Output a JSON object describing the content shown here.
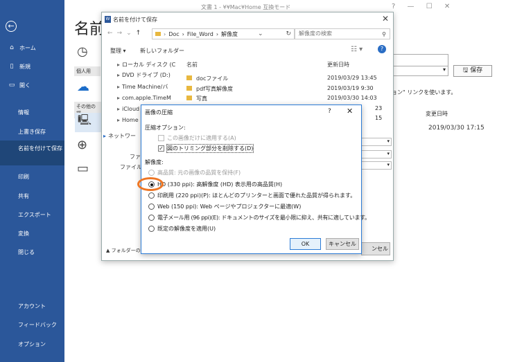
{
  "window": {
    "title": "文書 1 - ¥¥Mac¥Home 互換モード",
    "controls": [
      "?",
      "—",
      "☐",
      "✕"
    ]
  },
  "sidebar": {
    "items": [
      {
        "label": "ホーム",
        "icon": "home-icon"
      },
      {
        "label": "新規",
        "icon": "new-document-icon"
      },
      {
        "label": "開く",
        "icon": "open-folder-icon"
      },
      {
        "label": "情報"
      },
      {
        "label": "上書き保存"
      },
      {
        "label": "名前を付けて保存"
      },
      {
        "label": "印刷"
      },
      {
        "label": "共有"
      },
      {
        "label": "エクスポート"
      },
      {
        "label": "変換"
      },
      {
        "label": "閉じる"
      },
      {
        "label": "アカウント"
      },
      {
        "label": "フィードバック"
      },
      {
        "label": "オプション"
      }
    ]
  },
  "background": {
    "heading": "名前",
    "personal_label": "個人用",
    "other_label": "その他の場",
    "save_button": "保存",
    "note": "ョン\" リンクを使います。",
    "mod_date_header": "変更日時",
    "mod_date": "2019/03/30 17:15"
  },
  "saveas": {
    "title": "名前を付けて保存",
    "path": [
      "Doc",
      "File_Word",
      "解像度"
    ],
    "search_placeholder": "解像度の検索",
    "organize": "整理 ▾",
    "new_folder": "新しいフォルダー",
    "nav": [
      {
        "label": "ローカル ディスク (C"
      },
      {
        "label": "DVD ドライブ (D:)"
      },
      {
        "label": "Time Machine/バ"
      },
      {
        "label": "com.apple.TimeM"
      },
      {
        "label": "iCloud"
      },
      {
        "label": "Home"
      },
      {
        "label": "ネットワー"
      }
    ],
    "columns": {
      "name": "名前",
      "date": "更新日時"
    },
    "files": [
      {
        "name": "docファイル",
        "date": "2019/03/29 13:45"
      },
      {
        "name": "pdf写真解像度",
        "date": "2019/03/19 9:30"
      },
      {
        "name": "写真",
        "date": "2019/03/30 14:03"
      }
    ],
    "partial_dates": [
      "23",
      "15"
    ],
    "filename_label": "ファイ",
    "filetype_label": "ファイルの",
    "hide_folders": "フォルダーの非",
    "cancel_partial": "ンセル"
  },
  "compress": {
    "title": "画像の圧縮",
    "help": "?",
    "close": "✕",
    "options_heading": "圧縮オプション:",
    "checkbox_apply_only": "この画像だけに適用する(A)",
    "checkbox_delete_cropped": "図のトリミング部分を削除する(D)",
    "resolution_heading": "解像度:",
    "radios": [
      {
        "label": "高品質: 元の画像の品質を保持(F)",
        "disabled": true,
        "checked": false
      },
      {
        "label": "HD (330 ppi): 高解像度 (HD) 表示用の高品質(H)",
        "disabled": false,
        "checked": true
      },
      {
        "label": "印刷用 (220 ppi)(P): ほとんどのプリンターと画面で優れた品質が得られます。",
        "disabled": false,
        "checked": false
      },
      {
        "label": "Web (150 ppi): Web ページやプロジェクターに最適(W)",
        "disabled": false,
        "checked": false
      },
      {
        "label": "電子メール用 (96 ppi)(E): ドキュメントのサイズを最小限に抑え、共有に適しています。",
        "disabled": false,
        "checked": false
      },
      {
        "label": "既定の解像度を適用(U)",
        "disabled": false,
        "checked": false
      }
    ],
    "ok": "OK",
    "cancel": "キャンセル"
  },
  "colors": {
    "sidebar": "#2b579a",
    "sidebar_selected": "#1f4678",
    "highlight_circle": "#ee7624",
    "dialog_border": "#2b7bd6"
  }
}
